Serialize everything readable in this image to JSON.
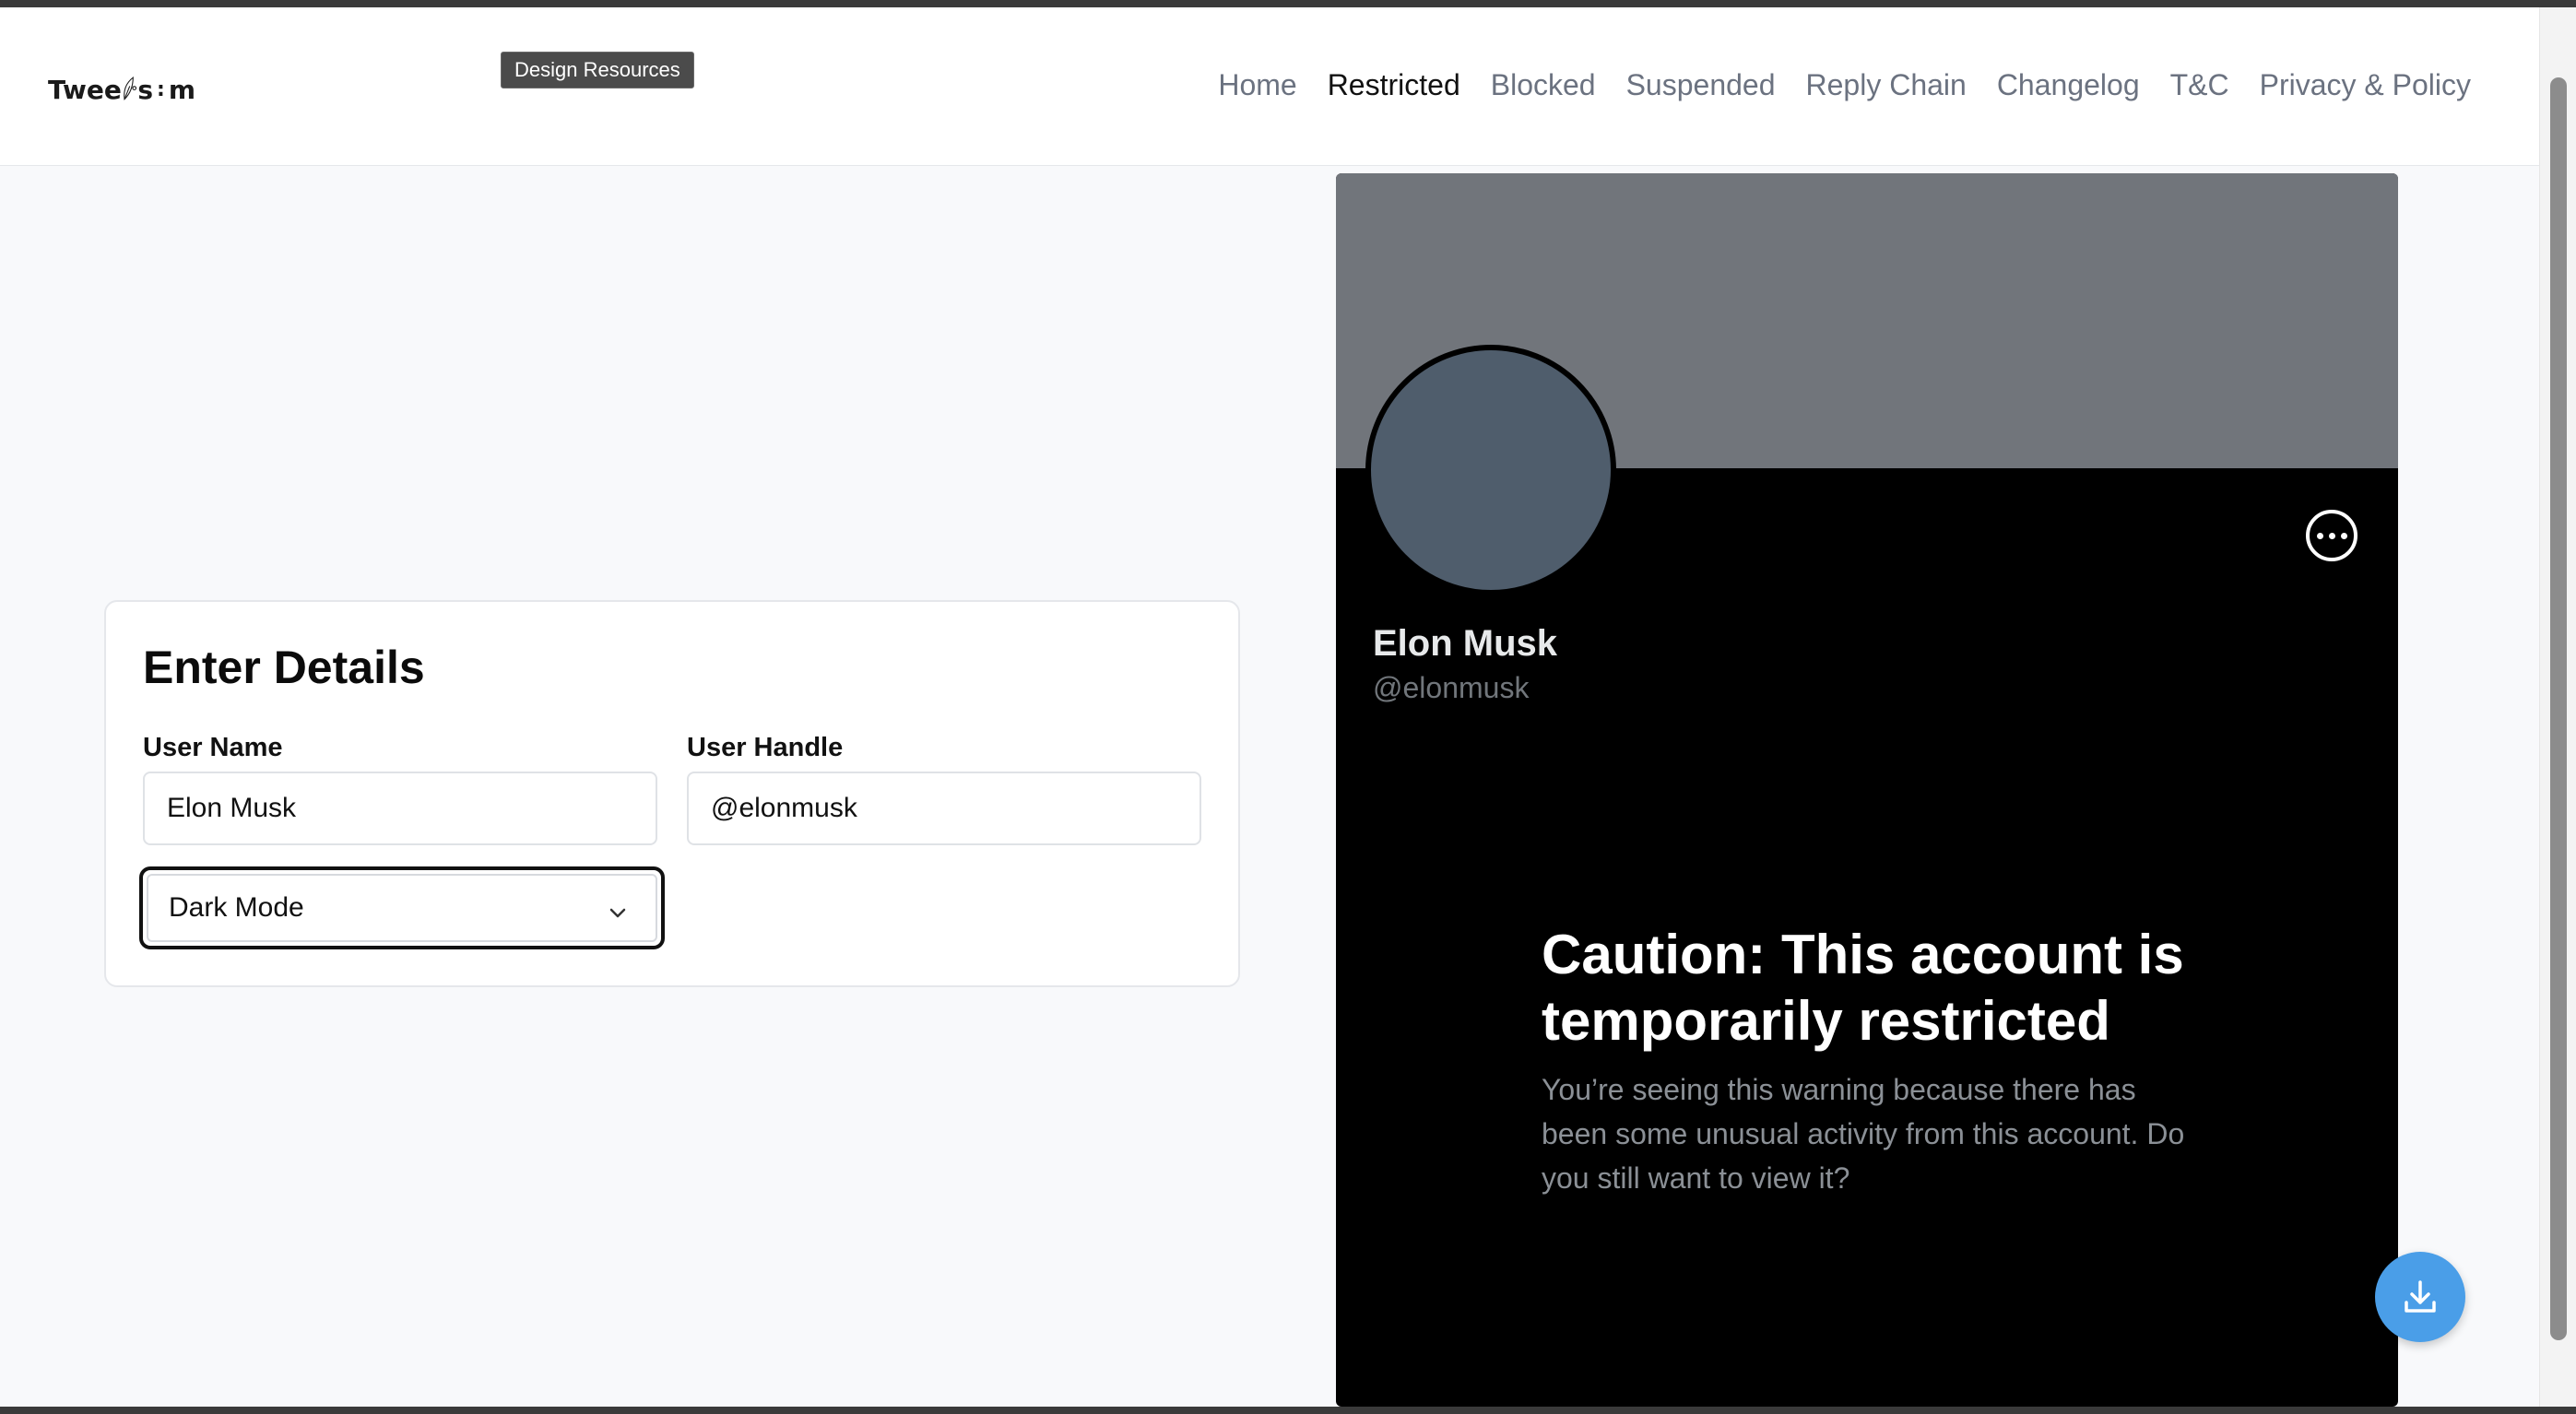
{
  "header": {
    "logo_text_left": "Twee",
    "logo_text_right": "s",
    "logo_text_end": "m",
    "tooltip": "Design Resources",
    "nav": [
      {
        "label": "Home",
        "active": false
      },
      {
        "label": "Restricted",
        "active": true
      },
      {
        "label": "Blocked",
        "active": false
      },
      {
        "label": "Suspended",
        "active": false
      },
      {
        "label": "Reply Chain",
        "active": false
      },
      {
        "label": "Changelog",
        "active": false
      },
      {
        "label": "T&C",
        "active": false
      },
      {
        "label": "Privacy & Policy",
        "active": false
      }
    ]
  },
  "form": {
    "title": "Enter Details",
    "user_name_label": "User Name",
    "user_name_value": "Elon Musk",
    "user_handle_label": "User Handle",
    "user_handle_value": "@elonmusk",
    "theme_selected": "Dark Mode"
  },
  "preview": {
    "name": "Elon Musk",
    "handle": "@elonmusk",
    "caution_title": "Caution: This account is temporarily restricted",
    "caution_body": "You’re seeing this warning because there has been some unusual activity from this account. Do you still want to view it?"
  },
  "icons": {
    "more": "more-horizontal-icon",
    "download": "download-icon",
    "chevron": "chevron-down-icon"
  },
  "colors": {
    "accent": "#4a9ee8",
    "preview_bg": "#000000",
    "banner": "#71757b",
    "avatar": "#4f5d6c"
  }
}
